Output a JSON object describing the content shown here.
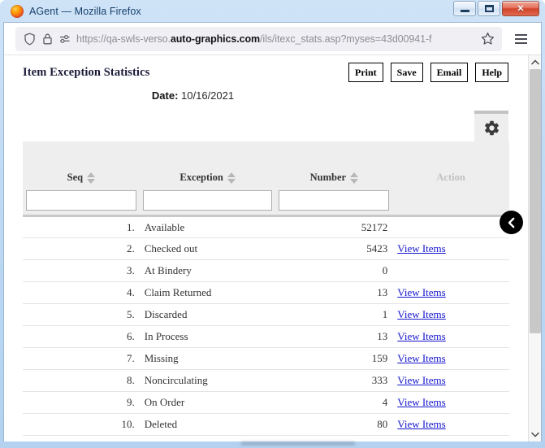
{
  "window": {
    "title": "AGent — Mozilla Firefox",
    "logo_icon": "firefox-logo",
    "minimize_label": "Minimize",
    "maximize_label": "Maximize",
    "close_label": "✕"
  },
  "browser": {
    "shield_icon": "shield-icon",
    "lock_icon": "lock-icon",
    "permissions_icon": "permissions-icon",
    "bookmark_icon": "star-icon",
    "menu_icon": "hamburger-menu-icon",
    "url": {
      "prefix": "https://qa-swls-verso.",
      "host": "auto-graphics.com",
      "suffix": "/ils/itexc_stats.asp?myses=43d00941-f",
      "full": "https://qa-swls-verso.auto-graphics.com/ils/itexc_stats.asp?myses=43d00941-f"
    }
  },
  "page": {
    "title": "Item Exception Statistics",
    "date_label": "Date:",
    "date_value": "10/16/2021",
    "settings_icon": "gear-icon",
    "collapse_icon": "chevron-left-icon",
    "buttons": [
      {
        "label": "Print",
        "name": "print-button"
      },
      {
        "label": "Save",
        "name": "save-button"
      },
      {
        "label": "Email",
        "name": "email-button"
      },
      {
        "label": "Help",
        "name": "help-button"
      }
    ]
  },
  "table": {
    "columns": [
      {
        "label": "Seq",
        "sortable": true
      },
      {
        "label": "Exception",
        "sortable": true
      },
      {
        "label": "Number",
        "sortable": true
      },
      {
        "label": "Action",
        "sortable": false
      }
    ],
    "filters": [
      {
        "value": "",
        "placeholder": ""
      },
      {
        "value": "",
        "placeholder": ""
      },
      {
        "value": "",
        "placeholder": ""
      }
    ],
    "action_link_label": "View Items",
    "rows": [
      {
        "seq": "1.",
        "exception": "Available",
        "number": "52172",
        "action": ""
      },
      {
        "seq": "2.",
        "exception": "Checked out",
        "number": "5423",
        "action": "View Items"
      },
      {
        "seq": "3.",
        "exception": "At Bindery",
        "number": "0",
        "action": ""
      },
      {
        "seq": "4.",
        "exception": "Claim Returned",
        "number": "13",
        "action": "View Items"
      },
      {
        "seq": "5.",
        "exception": "Discarded",
        "number": "1",
        "action": "View Items"
      },
      {
        "seq": "6.",
        "exception": "In Process",
        "number": "13",
        "action": "View Items"
      },
      {
        "seq": "7.",
        "exception": "Missing",
        "number": "159",
        "action": "View Items"
      },
      {
        "seq": "8.",
        "exception": "Noncirculating",
        "number": "333",
        "action": "View Items"
      },
      {
        "seq": "9.",
        "exception": "On Order",
        "number": "4",
        "action": "View Items"
      },
      {
        "seq": "10.",
        "exception": "Deleted",
        "number": "80",
        "action": "View Items"
      }
    ]
  },
  "scrollbar": {
    "up_icon": "chevron-up-icon",
    "down_icon": "chevron-down-icon"
  },
  "colors": {
    "link": "#1515cf",
    "header_band": "#eeeeee",
    "title_text": "#1b1b3a",
    "disabled_header": "#c2c2c2",
    "window_chrome": "#b4d2f0"
  }
}
